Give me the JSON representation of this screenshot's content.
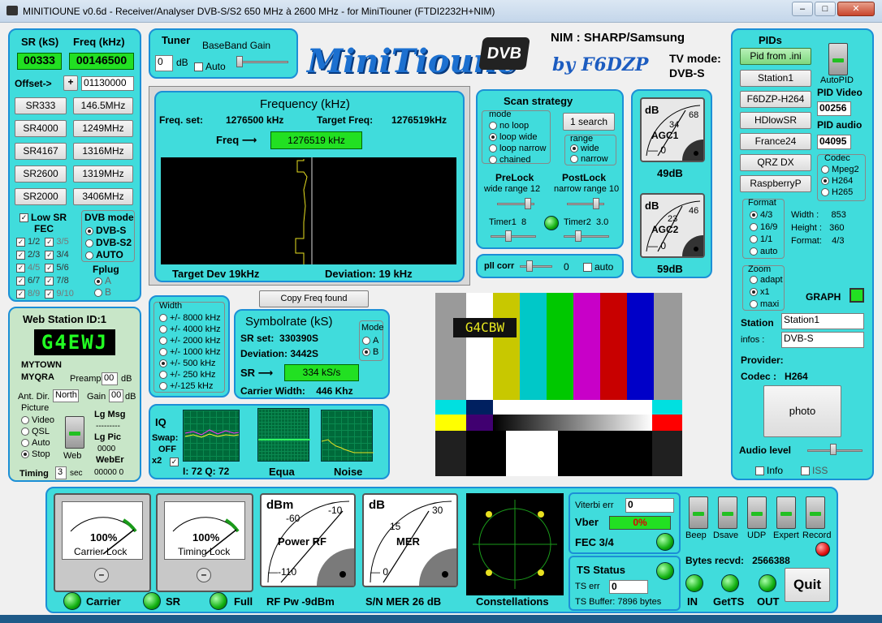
{
  "window": {
    "title": "MINITIOUNE v0.6d - Receiver/Analyser DVB-S/S2 650 MHz à 2600 MHz - for MiniTiouner (FTDI2232H+NIM)",
    "minimize": "–",
    "maximize": "□",
    "close": "✕"
  },
  "left": {
    "sr_label": "SR (kS)",
    "freq_label": "Freq (kHz)",
    "sr_value": "00333",
    "freq_value": "00146500",
    "offset_label": "Offset->",
    "offset_sign": "+",
    "offset_value": "01130000",
    "sr_buttons": [
      "SR333",
      "SR4000",
      "SR4167",
      "SR2600",
      "SR2000"
    ],
    "freq_buttons": [
      "146.5MHz",
      "1249MHz",
      "1316MHz",
      "1319MHz",
      "3406MHz"
    ],
    "lowsr": "Low SR",
    "fec": "FEC",
    "fec_items": [
      "1/2",
      "3/5",
      "2/3",
      "3/4",
      "4/5",
      "5/6",
      "6/7",
      "7/8",
      "8/9",
      "9/10"
    ],
    "dvb_mode": "DVB mode",
    "dvb_items": [
      "DVB-S",
      "DVB-S2",
      "AUTO"
    ],
    "fplug": "Fplug",
    "fplug_items": [
      "A",
      "B"
    ]
  },
  "web": {
    "title": "Web Station ID:1",
    "callsign": "G4EWJ",
    "town": "MYTOWN",
    "qra": "MYQRA",
    "preamp_label": "Preamp",
    "preamp": "00",
    "db": "dB",
    "antdir_label": "Ant. Dir.",
    "antdir": "North",
    "gain_label": "Gain",
    "gain": "00",
    "picture": "Picture",
    "picture_items": [
      "Video",
      "QSL",
      "Auto",
      "Stop"
    ],
    "web_label": "Web",
    "lgmsg": "Lg Msg",
    "dashes": "---------",
    "lgpic": "Lg Pic",
    "lgpic_val": "0000",
    "weber": "WebEr",
    "weber_val": "00000  0",
    "timing": "Timing",
    "timing_val": "3",
    "sec": "sec"
  },
  "tuner": {
    "title": "Tuner",
    "bbgain": "BaseBand Gain",
    "value": "0",
    "db": "dB",
    "auto": "Auto"
  },
  "logo": {
    "text": "MiniTioune",
    "dvb": "DVB",
    "by": "by F6DZP"
  },
  "nim": {
    "nim": "NIM : SHARP/Samsung",
    "tvmode": "TV mode:",
    "tvmode_val": "DVB-S"
  },
  "frequency": {
    "title": "Frequency (kHz)",
    "freq_set_label": "Freq. set:",
    "freq_set": "1276500 kHz",
    "target_label": "Target Freq:",
    "target": "1276519kHz",
    "freq_arrow": "Freq ⟶",
    "freq_value": "1276519 kHz",
    "target_dev": "Target Dev 19kHz",
    "deviation": "Deviation: 19 kHz"
  },
  "copy_freq": "Copy Freq found",
  "scan": {
    "title": "Scan strategy",
    "mode": "mode",
    "modes": [
      "no loop",
      "loop wide",
      "loop narrow",
      "chained"
    ],
    "search": "1 search",
    "range": "range",
    "ranges": [
      "wide",
      "narrow"
    ],
    "prelock": "PreLock",
    "postlock": "PostLock",
    "wide_range": "wide range",
    "wide_val": "12",
    "narrow_range": "narrow range",
    "narrow_val": "10",
    "timer1": "Timer1",
    "timer1_val": "8",
    "timer2": "Timer2",
    "timer2_val": "3.0"
  },
  "pll": {
    "label": "pll corr",
    "value": "0",
    "auto": "auto"
  },
  "agc": {
    "agc1": "AGC1",
    "agc1_db": "49dB",
    "agc2": "AGC2",
    "agc2_db": "59dB",
    "db": "dB",
    "m1": "34",
    "m1b": "68",
    "m2": "23",
    "m2b": "46",
    "zero": "0"
  },
  "width": {
    "title": "Width",
    "items": [
      "+/- 8000 kHz",
      "+/- 4000 kHz",
      "+/- 2000 kHz",
      "+/- 1000 kHz",
      "+/- 500 kHz",
      "+/- 250 kHz",
      "+/-125 kHz"
    ]
  },
  "symbol": {
    "title": "Symbolrate (kS)",
    "srset_label": "SR set:",
    "srset": "330390S",
    "dev_label": "Deviation:",
    "dev": "3442S",
    "mode": "Mode",
    "modes": [
      "A",
      "B"
    ],
    "sr_arrow": "SR ⟶",
    "sr_value": "334 kS/s",
    "carrier_label": "Carrier Width:",
    "carrier": "446 Khz"
  },
  "iq": {
    "iq": "IQ",
    "swap": "Swap:",
    "off": "OFF",
    "x2": "x2",
    "iq_vals": "I: 72 Q: 72",
    "equa": "Equa",
    "noise": "Noise"
  },
  "video": {
    "overlay": "G4CBW"
  },
  "pids": {
    "title": "PIDs",
    "pid_ini": "Pid from .ini",
    "autopid": "AutoPID",
    "stations": [
      "Station1",
      "F6DZP-H264",
      "HDlowSR",
      "France24",
      "QRZ DX",
      "RaspberryP"
    ],
    "pid_video": "PID Video",
    "pid_video_val": "00256",
    "pid_audio": "PID audio",
    "pid_audio_val": "04095",
    "codec": "Codec",
    "codecs": [
      "Mpeg2",
      "H264",
      "H265"
    ],
    "format": "Format",
    "formats": [
      "4/3",
      "16/9",
      "1/1",
      "auto"
    ],
    "width_lbl": "Width :",
    "width_val": "853",
    "height_lbl": "Height :",
    "height_val": "360",
    "format_lbl": "Format:",
    "format_val": "4/3",
    "zoom": "Zoom",
    "zooms": [
      "adapt",
      "x1",
      "maxi"
    ],
    "graph": "GRAPH",
    "station_lbl": "Station",
    "station_val": "Station1",
    "infos_lbl": "infos :",
    "infos_val": "DVB-S",
    "provider": "Provider:",
    "codec_lbl": "Codec :",
    "codec_val": "H264",
    "photo": "photo",
    "audio": "Audio level",
    "info": "Info",
    "iss": "ISS"
  },
  "bottom": {
    "carrier_lock": "Carrier Lock",
    "timing_lock": "Timing Lock",
    "pct": "100%",
    "power_rf": "Power RF",
    "dbm": "dBm",
    "mer": "MER",
    "db": "dB",
    "m60": "-60",
    "m10": "-10",
    "m110": "-110",
    "m15": "15",
    "m30": "30",
    "m0": "0",
    "carrier": "Carrier",
    "sr": "SR",
    "full": "Full",
    "rfpw": "RF Pw -9dBm",
    "snmer": "S/N MER  26 dB",
    "constellations": "Constellations",
    "viterbi": "Viterbi err",
    "viterbi_val": "0",
    "vber": "Vber",
    "vber_val": "0%",
    "fec": "FEC 3/4",
    "ts": "TS Status",
    "tserr": "TS err",
    "tserr_val": "0",
    "tsbuf": "TS Buffer: 7896 bytes",
    "switches": [
      "Beep",
      "Dsave",
      "UDP",
      "Expert",
      "Record"
    ],
    "bytes": "Bytes recvd:",
    "bytes_val": "2566388",
    "in": "IN",
    "getts": "GetTS",
    "out": "OUT",
    "quit": "Quit"
  }
}
